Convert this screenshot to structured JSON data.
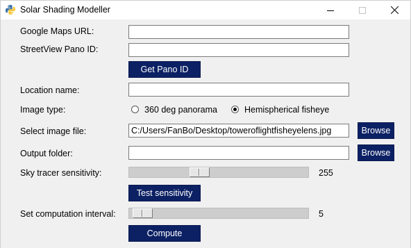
{
  "window": {
    "title": "Solar Shading Modeller"
  },
  "form": {
    "google_maps_url": {
      "label": "Google Maps URL:",
      "value": ""
    },
    "streetview_pano_id": {
      "label": "StreetView Pano ID:",
      "value": ""
    },
    "get_pano_id_button": "Get Pano ID",
    "location_name": {
      "label": "Location name:",
      "value": ""
    },
    "image_type": {
      "label": "Image type:",
      "options": [
        "360 deg panorama",
        "Hemispherical fisheye"
      ],
      "selected": "Hemispherical fisheye"
    },
    "image_file": {
      "label": "Select image file:",
      "value": "C:/Users/FanBo/Desktop/toweroflightfisheyelens.jpg",
      "browse": "Browse"
    },
    "output_folder": {
      "label": "Output folder:",
      "value": "",
      "browse": "Browse"
    },
    "sky_tracer_sensitivity": {
      "label": "Sky tracer sensitivity:",
      "value": "255",
      "level": 0.38
    },
    "test_sensitivity_button": "Test sensitivity",
    "computation_interval": {
      "label": "Set computation interval:",
      "value": "5",
      "level": 0.02
    },
    "compute_button": "Compute"
  },
  "colors": {
    "button_bg": "#0c2164",
    "window_bg": "#f0f0f0"
  }
}
